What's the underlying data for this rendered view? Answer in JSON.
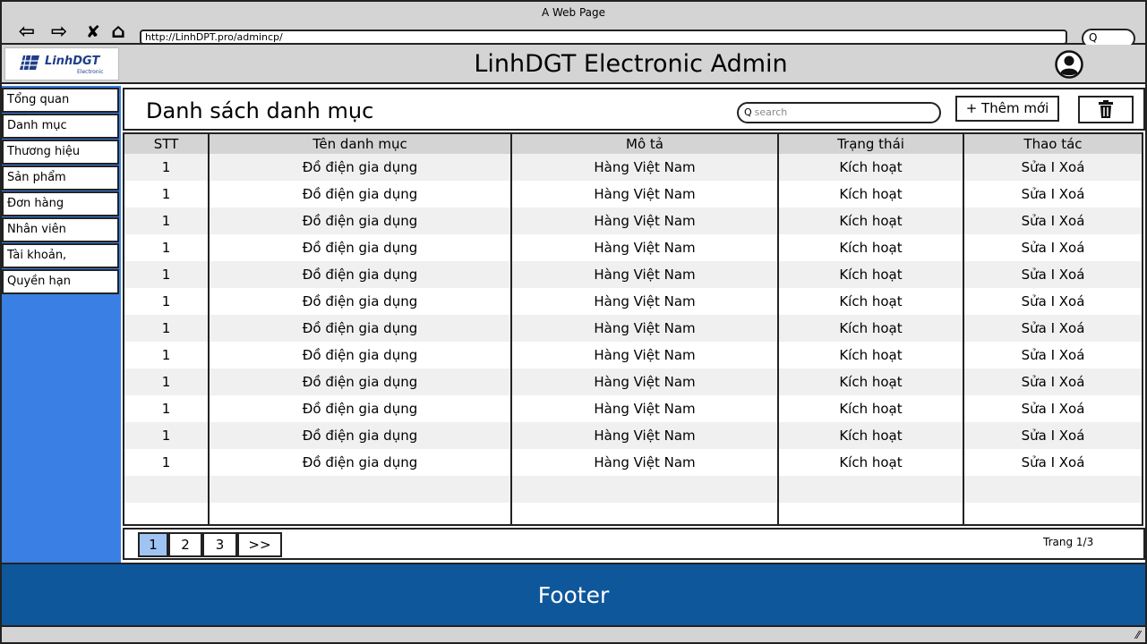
{
  "browser": {
    "title": "A Web Page",
    "url": "http://LinhDPT.pro/admincp/",
    "back_glyph": "⇦",
    "forward_glyph": "⇨",
    "close_glyph": "✘",
    "home_glyph": "⌂",
    "search_glyph": "Q"
  },
  "header": {
    "logo_name": "LinhDGT",
    "logo_sub": "Electronic",
    "title": "LinhDGT Electronic Admin"
  },
  "sidebar": {
    "items": [
      {
        "label": "Tổng quan"
      },
      {
        "label": "Danh mục"
      },
      {
        "label": "Thương hiệu"
      },
      {
        "label": "Sản phẩm"
      },
      {
        "label": "Đơn hàng"
      },
      {
        "label": "Nhân viên"
      },
      {
        "label": "Tài khoản,"
      },
      {
        "label": "Quyền hạn"
      }
    ]
  },
  "content": {
    "page_title": "Danh sách danh mục",
    "search_placeholder": "search",
    "search_glyph": "Q",
    "add_label": "+ Thêm mới"
  },
  "table": {
    "columns": [
      "STT",
      "Tên danh mục",
      "Mô tả",
      "Trạng thái",
      "Thao tác"
    ],
    "rows": [
      [
        "1",
        "Đồ điện gia dụng",
        "Hàng Việt Nam",
        "Kích hoạt",
        "Sửa I Xoá"
      ],
      [
        "1",
        "Đồ điện gia dụng",
        "Hàng Việt Nam",
        "Kích hoạt",
        "Sửa I Xoá"
      ],
      [
        "1",
        "Đồ điện gia dụng",
        "Hàng Việt Nam",
        "Kích hoạt",
        "Sửa I Xoá"
      ],
      [
        "1",
        "Đồ điện gia dụng",
        "Hàng Việt Nam",
        "Kích hoạt",
        "Sửa I Xoá"
      ],
      [
        "1",
        "Đồ điện gia dụng",
        "Hàng Việt Nam",
        "Kích hoạt",
        "Sửa I Xoá"
      ],
      [
        "1",
        "Đồ điện gia dụng",
        "Hàng Việt Nam",
        "Kích hoạt",
        "Sửa I Xoá"
      ],
      [
        "1",
        "Đồ điện gia dụng",
        "Hàng Việt Nam",
        "Kích hoạt",
        "Sửa I Xoá"
      ],
      [
        "1",
        "Đồ điện gia dụng",
        "Hàng Việt Nam",
        "Kích hoạt",
        "Sửa I Xoá"
      ],
      [
        "1",
        "Đồ điện gia dụng",
        "Hàng Việt Nam",
        "Kích hoạt",
        "Sửa I Xoá"
      ],
      [
        "1",
        "Đồ điện gia dụng",
        "Hàng Việt Nam",
        "Kích hoạt",
        "Sửa I Xoá"
      ],
      [
        "1",
        "Đồ điện gia dụng",
        "Hàng Việt Nam",
        "Kích hoạt",
        "Sửa I Xoá"
      ],
      [
        "1",
        "Đồ điện gia dụng",
        "Hàng Việt Nam",
        "Kích hoạt",
        "Sửa I Xoá"
      ],
      [
        "",
        "",
        "",
        "",
        ""
      ],
      [
        "",
        "",
        "",
        "",
        ""
      ]
    ]
  },
  "pagination": {
    "pages": [
      "1",
      "2",
      "3"
    ],
    "next_label": ">>",
    "active_page": "1",
    "info": "Trang 1/3"
  },
  "footer": {
    "label": "Footer"
  },
  "colors": {
    "sidebar_bg": "#3a7fe4",
    "footer_bg": "#0e579b",
    "chrome_bg": "#d4d4d4",
    "active_page": "#9fc4f4"
  },
  "icons": [
    "back-arrow-icon",
    "forward-arrow-icon",
    "close-icon",
    "home-icon",
    "search-icon",
    "user-avatar-icon",
    "trash-icon",
    "logo-icon"
  ]
}
